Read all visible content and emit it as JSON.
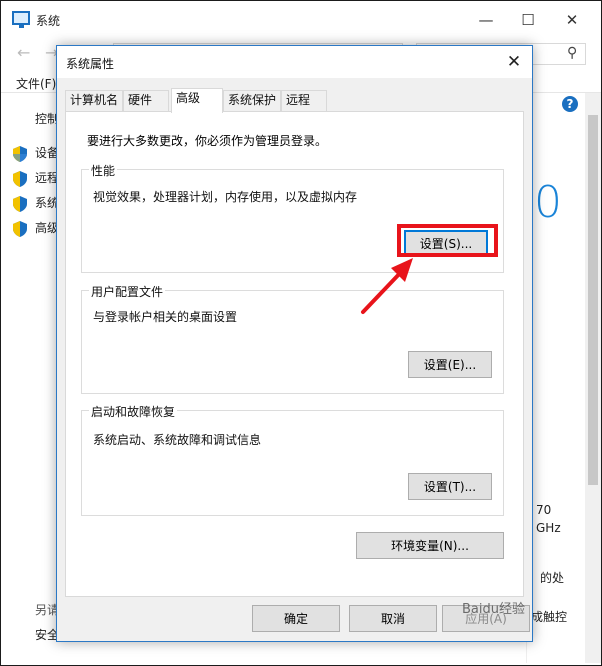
{
  "background_window": {
    "title": "系统",
    "menu_file": "文件(F)",
    "control_panel": "控制",
    "side_items": [
      "设备",
      "远程",
      "系统",
      "高级"
    ],
    "big_number": "0",
    "right_fragments": [
      "70",
      "GHz",
      "的处",
      "成触控"
    ],
    "other": "另请",
    "security": "安全"
  },
  "dialog": {
    "title": "系统属性",
    "close_glyph": "✕",
    "tabs": [
      {
        "label": "计算机名",
        "active": false
      },
      {
        "label": "硬件",
        "active": false
      },
      {
        "label": "高级",
        "active": true
      },
      {
        "label": "系统保护",
        "active": false
      },
      {
        "label": "远程",
        "active": false
      }
    ],
    "admin_note": "要进行大多数更改，你必须作为管理员登录。",
    "performance": {
      "title": "性能",
      "desc": "视觉效果，处理器计划，内存使用，以及虚拟内存",
      "button": "设置(S)..."
    },
    "user_profiles": {
      "title": "用户配置文件",
      "desc": "与登录帐户相关的桌面设置",
      "button": "设置(E)..."
    },
    "startup_recovery": {
      "title": "启动和故障恢复",
      "desc": "系统启动、系统故障和调试信息",
      "button": "设置(T)..."
    },
    "env_button": "环境变量(N)...",
    "ok": "确定",
    "cancel": "取消",
    "apply": "应用(A)"
  },
  "watermark": "Baidu经验",
  "colors": {
    "highlight": "#e8141b",
    "accent": "#0078d7"
  }
}
